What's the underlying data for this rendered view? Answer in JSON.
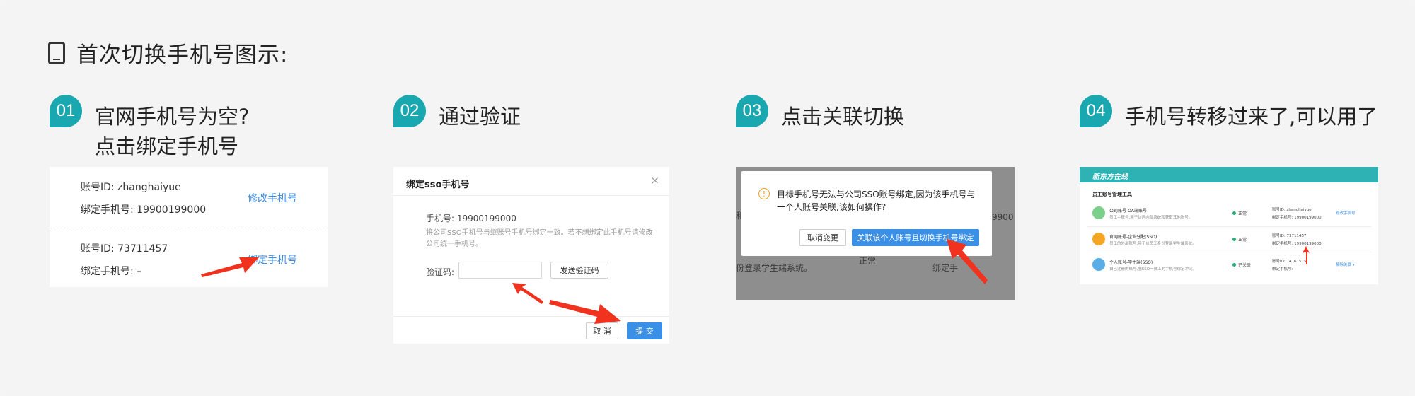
{
  "heading": {
    "title": "首次切换手机号图示:",
    "icon": "phone-icon"
  },
  "steps": [
    {
      "number": "01",
      "line1": "官网手机号为空?",
      "line2": "点击绑定手机号"
    },
    {
      "number": "02",
      "line1": "通过验证"
    },
    {
      "number": "03",
      "line1": "点击关联切换"
    },
    {
      "number": "04",
      "line1": "手机号转移过来了,可以用了"
    }
  ],
  "card1": {
    "account1_id": "账号ID: zhanghaiyue",
    "account1_phone": "绑定手机号: 19900199000",
    "account1_link": "修改手机号",
    "account2_id": "账号ID: 73711457",
    "account2_phone": "绑定手机号: –",
    "account2_link": "绑定手机号"
  },
  "card2": {
    "title": "绑定sso手机号",
    "close": "×",
    "phone_label": "手机号: 19900199000",
    "hint": "将公司SSO手机号与继账号手机号绑定一致。若不想绑定此手机号请修改公司统一手机号。",
    "code_label": "验证码:",
    "send_code": "发送验证码",
    "cancel": "取 消",
    "submit": "提 交"
  },
  "card3": {
    "message": "目标手机号无法与公司SSO账号绑定,因为该手机号与一个人账号关联,该如何操作?",
    "cancel": "取消变更",
    "confirm": "关联该个人账号且切换手机号绑定",
    "bg_text1": "和",
    "bg_text2": "9900",
    "bg_text3": "份登录学生端系统。",
    "bg_text4": "正常",
    "bg_text5": "绑定手",
    "bg_text6": "–"
  },
  "card4": {
    "logo": "新东方在线",
    "section": "员工账号管理工具",
    "rows": [
      {
        "name": "公司账号-OA端账号",
        "desc": "员工主账号,用于访问内部系统和获取其他账号。",
        "status": "正常",
        "id": "账号ID: zhanghaiyue",
        "phone": "绑定手机号: 19900199000",
        "link": "修改手机号",
        "color": "#7ad08a"
      },
      {
        "name": "官网账号-企业分配(SSO)",
        "desc": "员工的外部账号,用于以员工身份登录学生端系统。",
        "status": "正常",
        "id": "账号ID: 73711457",
        "phone": "绑定手机号: 19900199000",
        "link": "",
        "color": "#f5a623"
      },
      {
        "name": "个人账号-学生端(SSO)",
        "desc": "自己注册的账号,脱SSO一员工的手机号绑定冲突。",
        "status": "已关联",
        "id": "账号ID: 74161575",
        "phone": "绑定手机号: –",
        "link": "解除关联 ▾",
        "color": "#5aaee8"
      }
    ]
  },
  "colors": {
    "accent": "#1aa8b0",
    "link": "#3b8ee8",
    "arrow": "#f0321e"
  }
}
